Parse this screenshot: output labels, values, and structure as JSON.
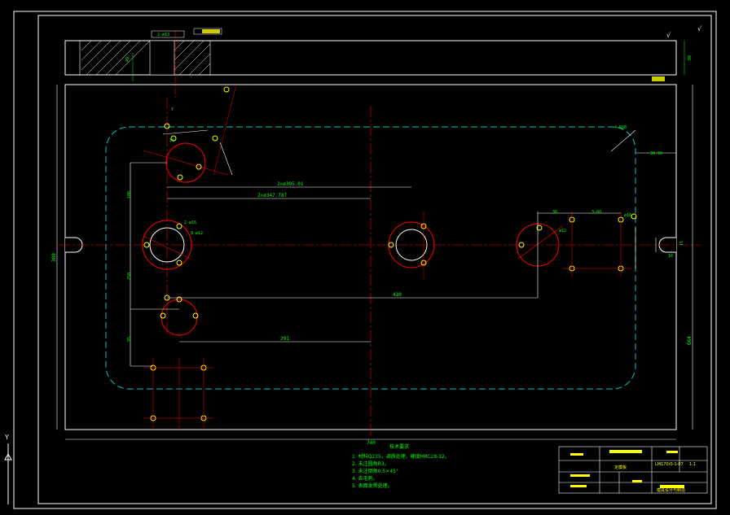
{
  "drawing": {
    "dimensions": {
      "width_total": "740",
      "height_total": "380",
      "inner_height": "664",
      "center_to_center": "430",
      "pos_291": "291",
      "pos_395": "2×ø395.01",
      "pos_347": "2×ø347.787",
      "left_160": "160",
      "left_250": "250",
      "left_95": "95",
      "small_36": "36",
      "small_100": "100",
      "top_dim": "2-ø13",
      "right_dim": "30.99",
      "corner_r": "4-R38",
      "hole_dim_a": "2-ø16",
      "hole_dim_b": "8-ø12",
      "right_60": "3-60",
      "right_36": "36",
      "right_16": "ø16",
      "right_418": "ø12",
      "side_15": "15",
      "side_10": "10",
      "section_80": "80",
      "section_40": "40"
    },
    "notes": {
      "title": "技术要求",
      "items": [
        "1. 材料Q235，调质处理，硬度HRC28-32。",
        "2. 未注圆角R3。",
        "3. 未注倒角0.5×45°",
        "4. 去毛刺。",
        "5. 表面发黑处理。"
      ]
    },
    "title_block": {
      "part_name": "定模板",
      "code": "LM170/0-1-07 ",
      "scale": "1:1",
      "company": "模具设计与制造"
    },
    "axis": {
      "y_label": "Y"
    }
  },
  "colors": {
    "outline": "#ffffff",
    "centerline": "#ff0000",
    "hidden": "#00c8c8",
    "dimension": "#00ff00",
    "title": "#ffff00"
  }
}
